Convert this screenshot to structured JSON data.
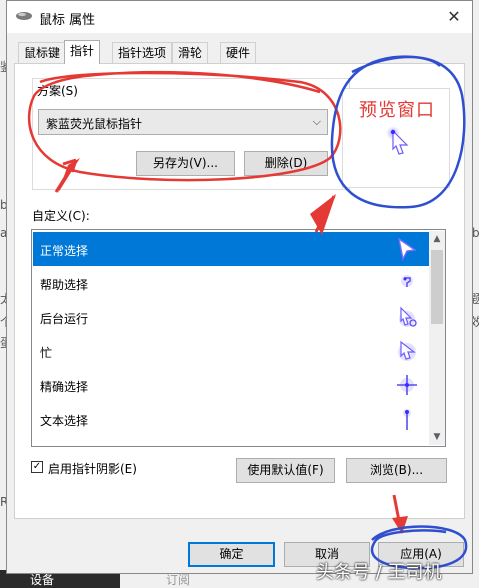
{
  "window": {
    "title": "鼠标 属性",
    "close_glyph": "✕"
  },
  "tabs": [
    {
      "label": "鼠标键",
      "active": false
    },
    {
      "label": "指针",
      "active": true
    },
    {
      "label": "指针选项",
      "active": false
    },
    {
      "label": "滑轮",
      "active": false
    },
    {
      "label": "硬件",
      "active": false
    }
  ],
  "scheme": {
    "label": "方案(S)",
    "selected": "紫蓝荧光鼠标指针",
    "save_as_label": "另存为(V)...",
    "delete_label": "删除(D)"
  },
  "preview": {
    "annotation": "预览窗口"
  },
  "customize": {
    "label": "自定义(C):",
    "items": [
      {
        "label": "正常选择",
        "icon": "arrow-cursor-icon",
        "selected": true
      },
      {
        "label": "帮助选择",
        "icon": "help-cursor-icon",
        "selected": false
      },
      {
        "label": "后台运行",
        "icon": "working-cursor-icon",
        "selected": false
      },
      {
        "label": "忙",
        "icon": "busy-cursor-icon",
        "selected": false
      },
      {
        "label": "精确选择",
        "icon": "crosshair-cursor-icon",
        "selected": false
      },
      {
        "label": "文本选择",
        "icon": "text-cursor-icon",
        "selected": false
      }
    ]
  },
  "shadow_checkbox": {
    "label": "启用指针阴影(E)",
    "checked": true,
    "check_glyph": "✓"
  },
  "buttons": {
    "use_default": "使用默认值(F)",
    "browse": "浏览(B)...",
    "ok": "确定",
    "cancel": "取消",
    "apply": "应用(A)"
  },
  "background_app": {
    "left_fragments": [
      "鉴",
      "b",
      "a",
      "R",
      "太",
      "个",
      "蛋"
    ],
    "right_fragments": [
      "b",
      "题",
      "效"
    ],
    "bottom_dark_text": "设备",
    "bottom_text": "订阅"
  },
  "watermark": "头条号 / 王司机",
  "colors": {
    "selection": "#0078d7",
    "annotation_red": "#e53935",
    "annotation_blue": "#2f4fd0",
    "cursor_glow": "#6a5cff"
  }
}
